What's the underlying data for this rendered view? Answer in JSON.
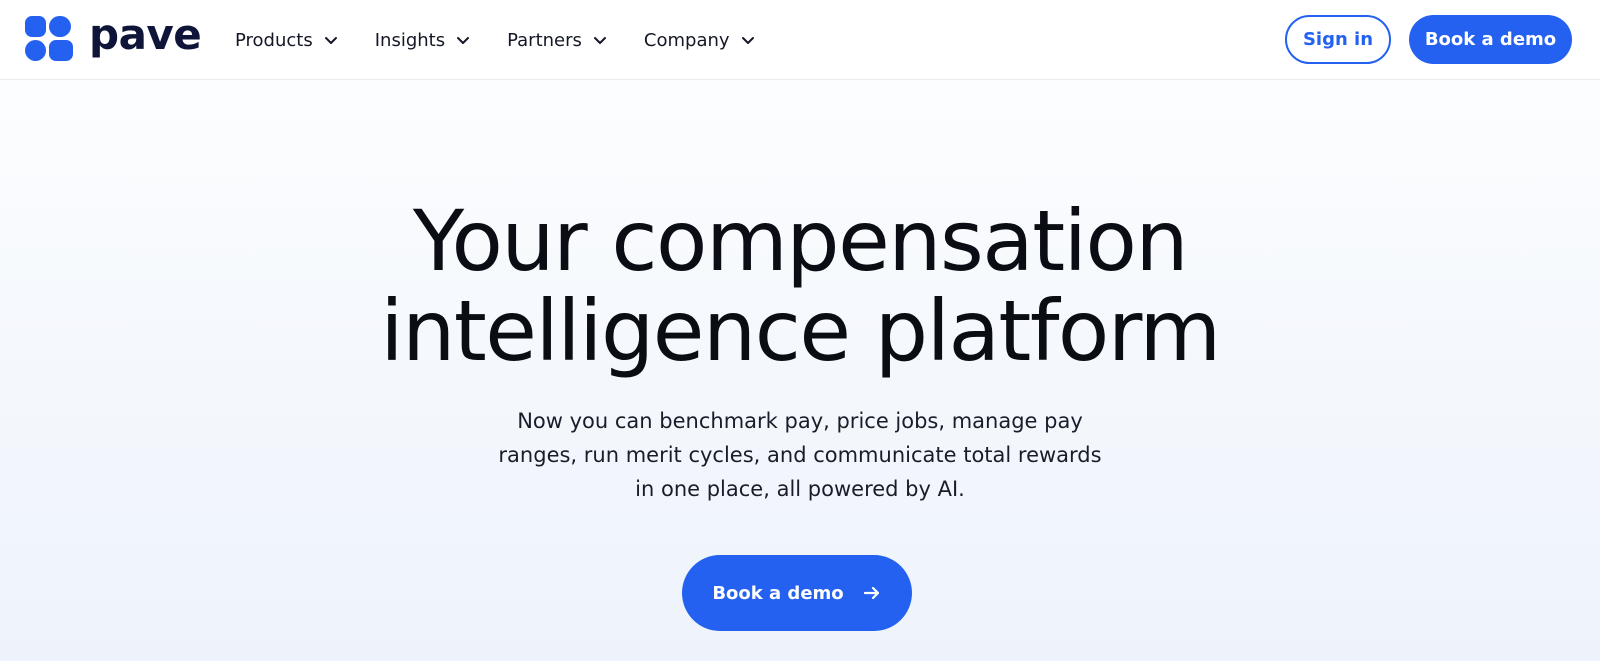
{
  "brand": {
    "name": "pave",
    "accent_color": "#2461f0",
    "logo_icon": "four-blob-grid-icon"
  },
  "nav": {
    "items": [
      {
        "label": "Products",
        "icon": "chevron-down-icon"
      },
      {
        "label": "Insights",
        "icon": "chevron-down-icon"
      },
      {
        "label": "Partners",
        "icon": "chevron-down-icon"
      },
      {
        "label": "Company",
        "icon": "chevron-down-icon"
      }
    ]
  },
  "header_actions": {
    "sign_in_label": "Sign in",
    "book_demo_label": "Book a demo"
  },
  "hero": {
    "title_line1": "Your compensation",
    "title_line2": "intelligence platform",
    "subtitle": "Now you can benchmark pay, price jobs, manage pay ranges, run merit cycles, and communicate total rewards in one place, all powered by AI.",
    "cta_label": "Book a demo",
    "cta_icon": "arrow-right-icon"
  }
}
